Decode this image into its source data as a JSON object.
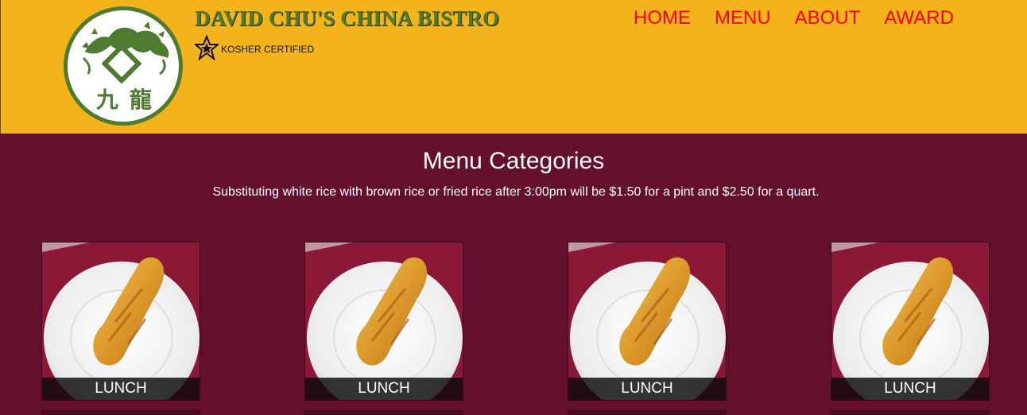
{
  "header": {
    "brand": "DAVID CHU'S CHINA BISTRO",
    "kosher_label": "KOSHER CERTIFIED",
    "logo_icon": "dragon-logo-icon",
    "star_icon": "kosher-star-icon"
  },
  "nav": {
    "items": [
      {
        "label": "HOME"
      },
      {
        "label": "MENU"
      },
      {
        "label": "ABOUT"
      },
      {
        "label": "AWARD"
      }
    ]
  },
  "main": {
    "title": "Menu Categories",
    "note": "Substituting white rice with brown rice or fried rice after 3:00pm will be $1.50 for a pint and $2.50 for a quart."
  },
  "categories": [
    {
      "label": "LUNCH",
      "image": "egg-roll-photo"
    },
    {
      "label": "LUNCH",
      "image": "egg-roll-photo"
    },
    {
      "label": "LUNCH",
      "image": "egg-roll-photo"
    },
    {
      "label": "LUNCH",
      "image": "egg-roll-photo"
    }
  ],
  "colors": {
    "header_bg": "#f4b31a",
    "page_bg": "#63102e",
    "nav_link": "#ff0000",
    "brand_green": "#4f7a32"
  }
}
